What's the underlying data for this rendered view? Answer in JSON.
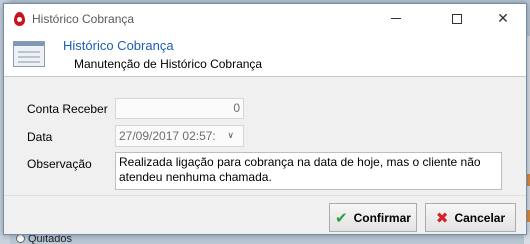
{
  "window": {
    "title": "Histórico Cobrança",
    "minimize_icon": "minimize-icon",
    "maximize_icon": "maximize-icon",
    "close_glyph": "✕"
  },
  "header": {
    "title": "Histórico Cobrança",
    "subtitle": "Manutenção de Histórico Cobrança"
  },
  "form": {
    "conta_receber_label": "Conta Receber",
    "conta_receber_value": "0",
    "data_label": "Data",
    "data_value": "27/09/2017 02:57:",
    "data_chevron": "∨",
    "observacao_label": "Observação",
    "observacao_value": "Realizada ligação para cobrança na data de hoje, mas o cliente não atendeu nenhuma chamada."
  },
  "buttons": {
    "confirm_label": "Confirmar",
    "confirm_icon_glyph": "✔",
    "cancel_label": "Cancelar",
    "cancel_icon_glyph": "✖"
  },
  "background": {
    "partial_text": "Quitados"
  },
  "colors": {
    "header_title": "#1a5fb4",
    "app_icon": "#c8141f",
    "confirm_icon": "#2f9e3a",
    "cancel_icon": "#d6232b"
  }
}
